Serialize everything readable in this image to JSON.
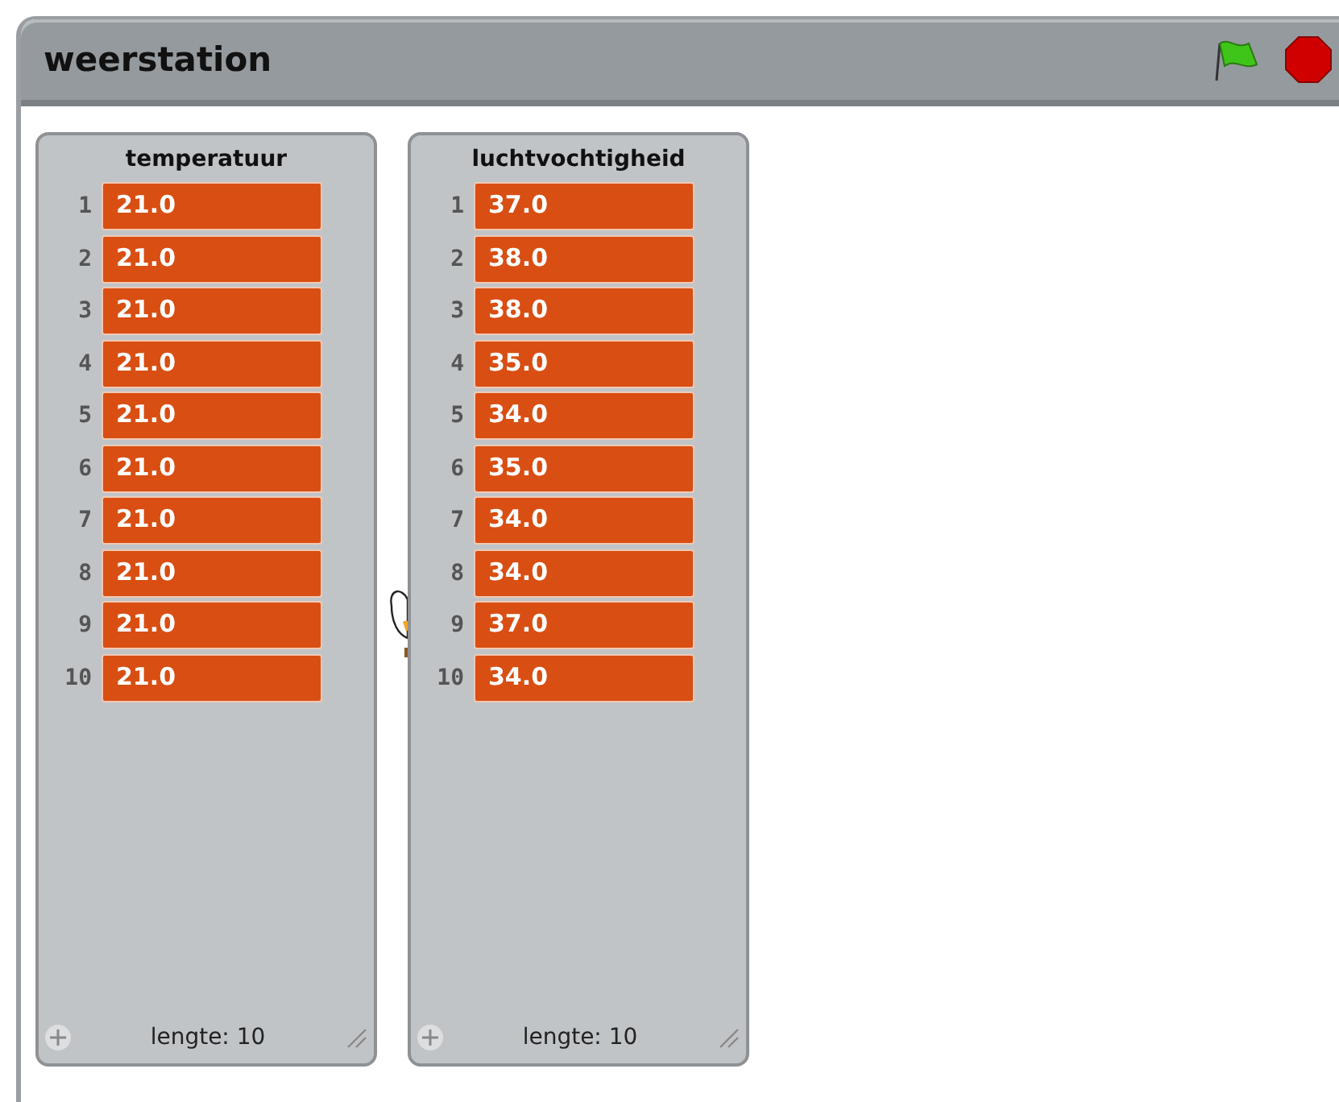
{
  "stage": {
    "title": "weerstation"
  },
  "lists": [
    {
      "title": "temperatuur",
      "items": [
        {
          "index": "1",
          "value": "21.0"
        },
        {
          "index": "2",
          "value": "21.0"
        },
        {
          "index": "3",
          "value": "21.0"
        },
        {
          "index": "4",
          "value": "21.0"
        },
        {
          "index": "5",
          "value": "21.0"
        },
        {
          "index": "6",
          "value": "21.0"
        },
        {
          "index": "7",
          "value": "21.0"
        },
        {
          "index": "8",
          "value": "21.0"
        },
        {
          "index": "9",
          "value": "21.0"
        },
        {
          "index": "10",
          "value": "21.0"
        }
      ],
      "length_label": "lengte: 10"
    },
    {
      "title": "luchtvochtigheid",
      "items": [
        {
          "index": "1",
          "value": "37.0"
        },
        {
          "index": "2",
          "value": "38.0"
        },
        {
          "index": "3",
          "value": "38.0"
        },
        {
          "index": "4",
          "value": "35.0"
        },
        {
          "index": "5",
          "value": "34.0"
        },
        {
          "index": "6",
          "value": "35.0"
        },
        {
          "index": "7",
          "value": "34.0"
        },
        {
          "index": "8",
          "value": "34.0"
        },
        {
          "index": "9",
          "value": "37.0"
        },
        {
          "index": "10",
          "value": "34.0"
        }
      ],
      "length_label": "lengte: 10"
    }
  ]
}
